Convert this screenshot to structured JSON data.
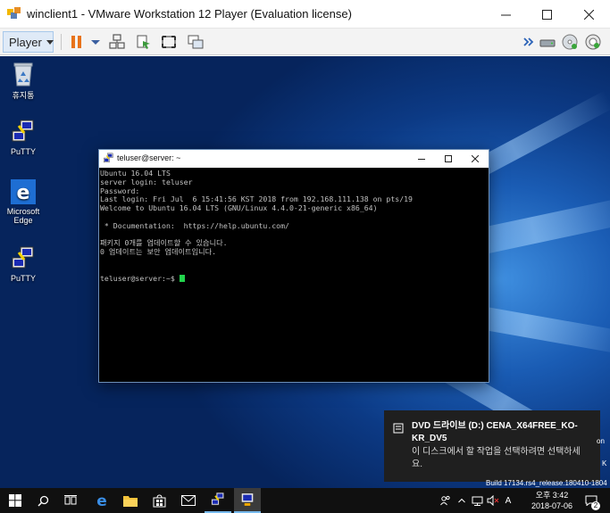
{
  "window": {
    "title": "winclient1 - VMware Workstation 12 Player (Evaluation license)"
  },
  "toolbar": {
    "player_label": "Player"
  },
  "desktop": {
    "icons": [
      {
        "label": "휴지통"
      },
      {
        "label": "PuTTY"
      },
      {
        "label": "Microsoft Edge"
      },
      {
        "label": "PuTTY"
      }
    ]
  },
  "putty": {
    "title": "teluser@server: ~",
    "terminal_lines": [
      "Ubuntu 16.04 LTS",
      "server login: teluser",
      "Password:",
      "Last login: Fri Jul  6 15:41:56 KST 2018 from 192.168.111.138 on pts/19",
      "Welcome to Ubuntu 16.04 LTS (GNU/Linux 4.4.0-21-generic x86_64)",
      "",
      " * Documentation:  https://help.ubuntu.com/",
      "",
      "패키지 0개를 업데이트할 수 있습니다.",
      "0 업데이트는 보안 업데이트입니다.",
      "",
      ""
    ],
    "prompt": "teluser@server:~$ "
  },
  "notification": {
    "title": "DVD 드라이브 (D:) CENA_X64FREE_KO-KR_DV5",
    "body": "이 디스크에서 할 작업을 선택하려면 선택하세요."
  },
  "watermark": {
    "line1": "on",
    "line2": "K",
    "line3": "Build 17134.rs4_release.180410-1804"
  },
  "taskbar": {
    "ime_label": "A",
    "clock_time": "오후 3:42",
    "clock_date": "2018-07-06",
    "notification_count": "2"
  },
  "colors": {
    "accent": "#76b9ed",
    "terminal_bg": "#000000",
    "terminal_fg": "#c0c0c0",
    "cursor": "#22d34c"
  }
}
